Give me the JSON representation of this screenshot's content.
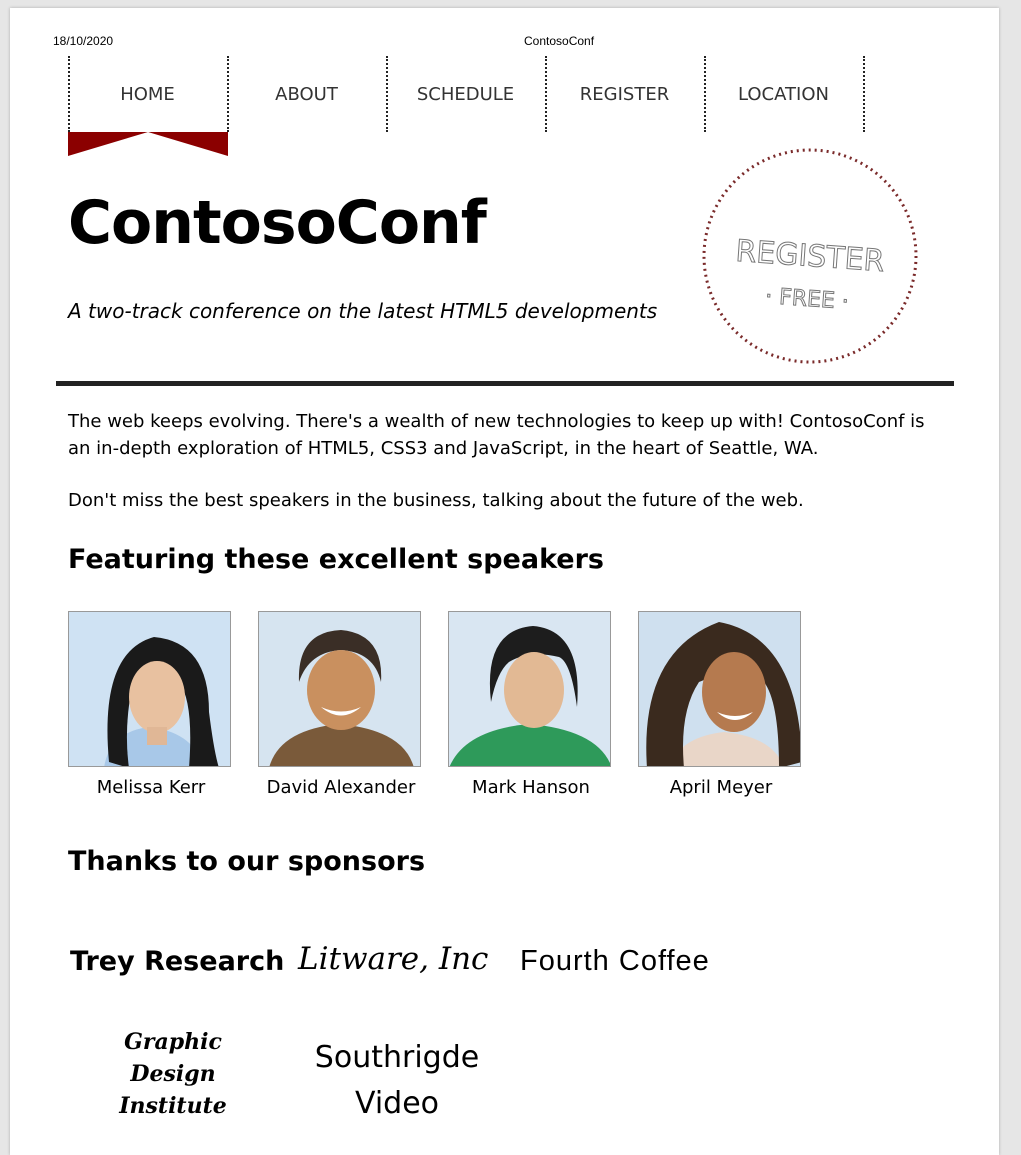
{
  "print_header": {
    "date": "18/10/2020",
    "title": "ContosoConf"
  },
  "nav": {
    "items": [
      {
        "label": "HOME"
      },
      {
        "label": "ABOUT"
      },
      {
        "label": "SCHEDULE"
      },
      {
        "label": "REGISTER"
      },
      {
        "label": "LOCATION"
      }
    ],
    "active_index": 0
  },
  "hero": {
    "title": "ContosoConf",
    "tagline": "A two-track conference on the latest HTML5 developments",
    "badge": {
      "line1": "REGISTER",
      "line2": "· FREE ·"
    }
  },
  "content": {
    "intro": "The web keeps evolving. There's a wealth of new technologies to keep up with! ContosoConf is an in-depth exploration of HTML5, CSS3 and JavaScript, in the heart of Seattle, WA.",
    "intro2": "Don't miss the best speakers in the business, talking about the future of the web."
  },
  "speakers": {
    "heading": "Featuring these excellent speakers",
    "list": [
      {
        "name": "Melissa Kerr"
      },
      {
        "name": "David Alexander"
      },
      {
        "name": "Mark Hanson"
      },
      {
        "name": "April Meyer"
      }
    ]
  },
  "sponsors": {
    "heading": "Thanks to our sponsors",
    "list": [
      {
        "name": "Trey Research"
      },
      {
        "name": "Litware, Inc"
      },
      {
        "name": "Fourth Coffee"
      },
      {
        "name": "Graphic Design Institute"
      },
      {
        "name": "Southrigde Video"
      }
    ]
  },
  "colors": {
    "accent": "#8b0000",
    "badge_ring": "#7a2a2a",
    "badge_text": "#777777",
    "rule": "#222222"
  }
}
